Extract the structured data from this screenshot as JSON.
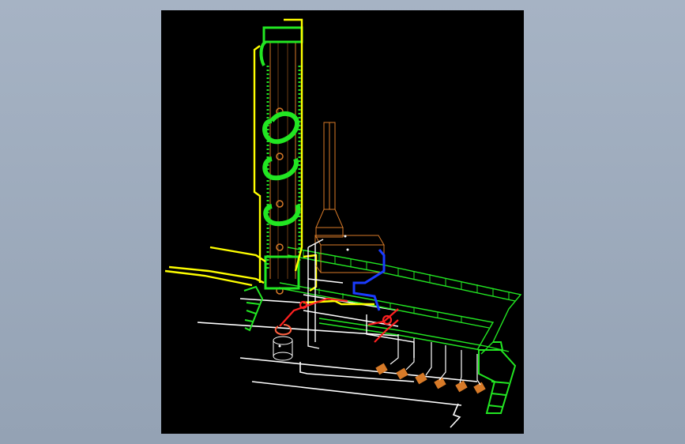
{
  "scene": {
    "background": "#000000",
    "frame_background": "#a0aec0",
    "colors": {
      "platform": "#22e622",
      "ladder": "#22e622",
      "column": "#d77a28",
      "pipe_primary": "#ffff00",
      "pipe_secondary": "#ffffff",
      "pipe_hot": "#ff2020",
      "pipe_blue": "#1a3cff",
      "stack": "#d77a28",
      "pump": "#d77a28"
    },
    "equipment": [
      {
        "name": "distillation-column"
      },
      {
        "name": "exhaust-stack"
      },
      {
        "name": "heat-exchanger-box"
      },
      {
        "name": "pump-row"
      },
      {
        "name": "vertical-tank"
      },
      {
        "name": "access-stairs"
      }
    ]
  }
}
